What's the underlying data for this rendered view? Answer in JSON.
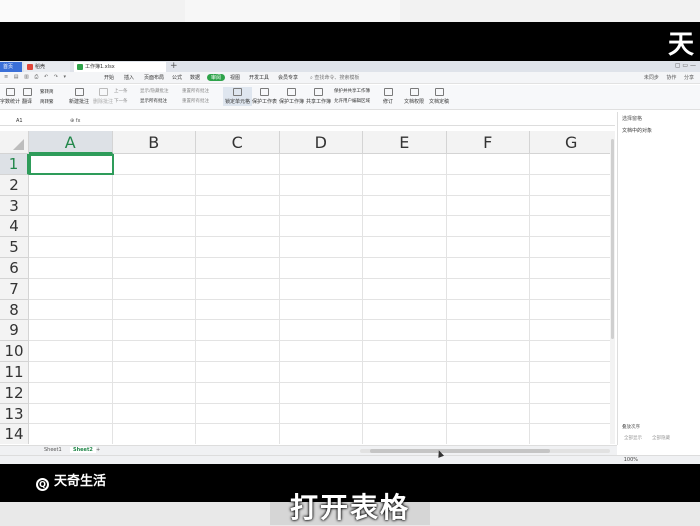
{
  "overlay": {
    "brand_top": "天",
    "logo_text": "天奇生活",
    "caption": "打开表格"
  },
  "tabs": [
    {
      "label": "首页"
    },
    {
      "label": "稻壳"
    },
    {
      "label": "工作簿1.xlsx"
    }
  ],
  "menu": {
    "items": [
      "开始",
      "插入",
      "页面布局",
      "公式",
      "数据",
      "审阅",
      "视图",
      "开发工具",
      "会员专享"
    ],
    "active_index": 5,
    "search_placeholder": "查找命令、搜索模板",
    "right_items": "未同步  协作  分享"
  },
  "ribbon": {
    "buttons": [
      "字数统计",
      "翻译",
      "新建批注",
      "删除批注",
      "锁定单元格",
      "保护工作表",
      "保护工作簿",
      "共享工作簿",
      "修订",
      "文档权限",
      "文档定稿"
    ],
    "small_items": [
      "繁转简",
      "简转繁",
      "上一条",
      "下一条",
      "显示/隐藏批注",
      "显示所有批注",
      "重置所有批注",
      "重置所有批注",
      "保护并共享工作簿",
      "允许用户编辑区域"
    ]
  },
  "formula_bar": {
    "cell_ref": "A1",
    "fx": "fx"
  },
  "grid": {
    "columns": [
      "A",
      "B",
      "C",
      "D",
      "E",
      "F",
      "G"
    ],
    "rows": [
      "1",
      "2",
      "3",
      "4",
      "5",
      "6",
      "7",
      "8",
      "9",
      "10",
      "11",
      "12",
      "13",
      "14"
    ],
    "active_cell": "A1"
  },
  "side_pane": {
    "header": "选择窗格",
    "title": "文档中的对象",
    "order_label": "叠放次序",
    "show_all": "全部显示",
    "hide_all": "全部隐藏"
  },
  "sheets": [
    "Sheet1",
    "Sheet2"
  ],
  "active_sheet_index": 1,
  "status": {
    "zoom": "100%"
  }
}
